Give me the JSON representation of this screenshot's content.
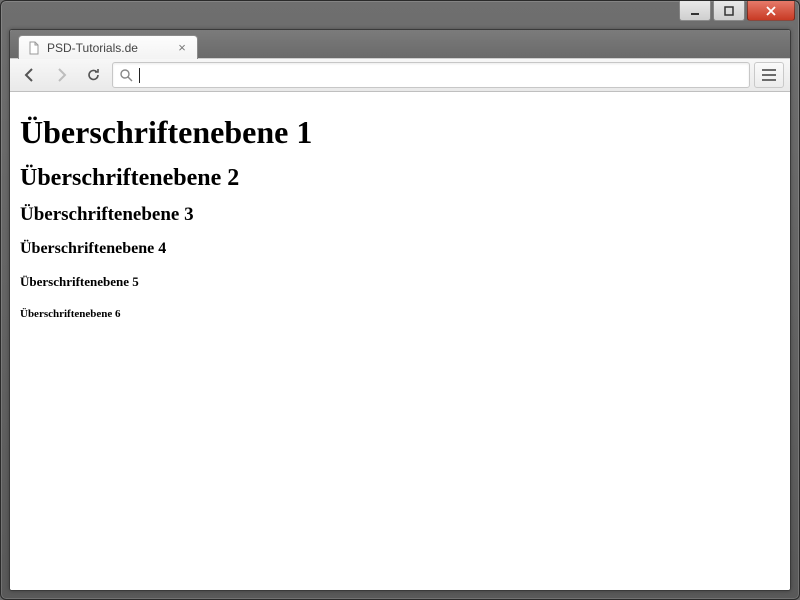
{
  "window": {
    "controls": {
      "minimize": "–",
      "maximize": "□",
      "close": "×"
    }
  },
  "tabs": [
    {
      "title": "PSD-Tutorials.de"
    }
  ],
  "omnibox": {
    "value": "",
    "placeholder": ""
  },
  "page": {
    "h1": "Überschriftenebene 1",
    "h2": "Überschriftenebene 2",
    "h3": "Überschriftenebene 3",
    "h4": "Überschriftenebene 4",
    "h5": "Überschriftenebene 5",
    "h6": "Überschriftenebene 6"
  }
}
